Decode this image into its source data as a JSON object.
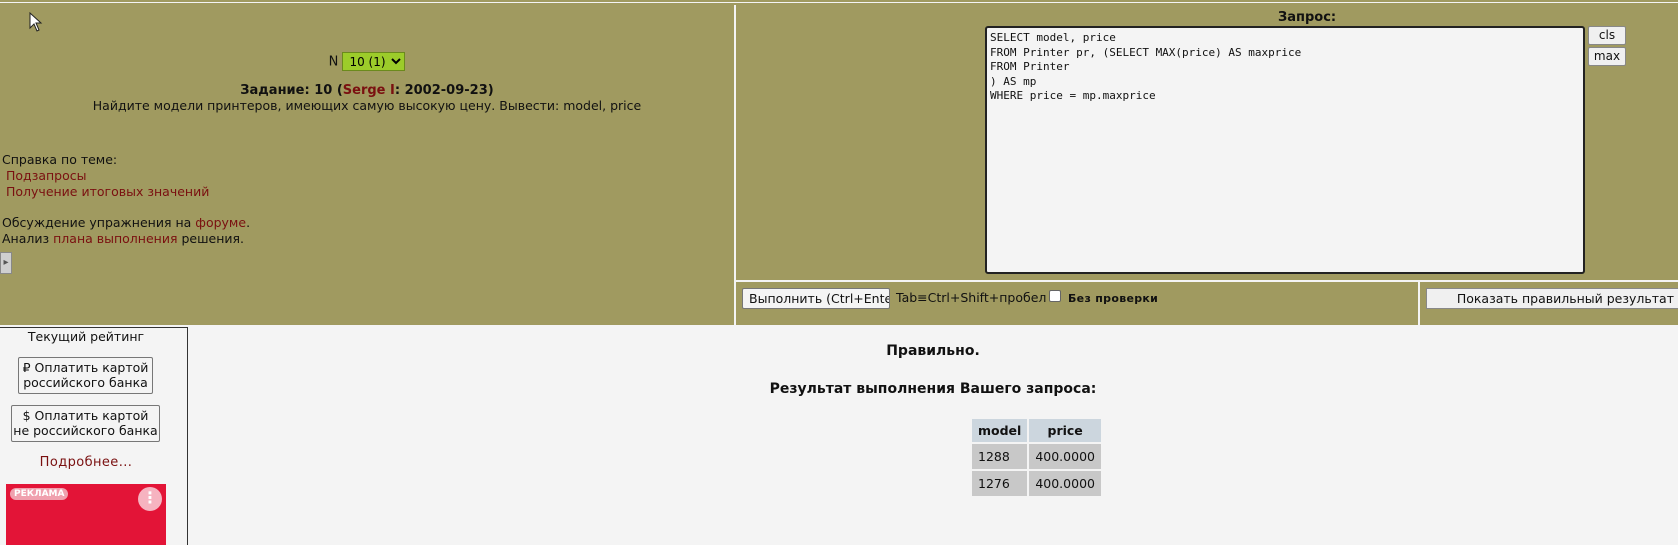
{
  "task": {
    "n_label": "N",
    "selected_option": "10 (1)",
    "title_prefix": "Задание: 10 (",
    "author": "Serge I",
    "title_suffix": ": 2002-09-23)",
    "description": "Найдите модели принтеров, имеющих самую высокую цену. Вывести: model, price"
  },
  "help": {
    "heading": "Справка по теме:",
    "links": [
      "Подзапросы",
      "Получение итоговых значений"
    ]
  },
  "discussion": {
    "prefix": "Обсуждение упражнения на ",
    "link": "форуме",
    "suffix": "."
  },
  "analysis": {
    "prefix": "Анализ ",
    "link": "плана выполнения",
    "suffix": " решения."
  },
  "query": {
    "label": "Запрос:",
    "text": "SELECT model, price\nFROM Printer pr, (SELECT MAX(price) AS maxprice\nFROM Printer\n) AS mp\nWHERE price = mp.maxprice",
    "cls_label": "cls",
    "max_label": "max"
  },
  "controls": {
    "execute_label": "Выполнить (Ctrl+Enter)",
    "tab_hint": "Tab≡Ctrl+Shift+пробел",
    "no_check_label": "Без проверки",
    "show_result_label": "Показать правильный результат"
  },
  "sidebar": {
    "rating_label": "Текущий рейтинг",
    "pay_ru_line1": "₽ Оплатить картой",
    "pay_ru_line2": "российского банка",
    "pay_nonru_line1": "$ Оплатить картой",
    "pay_nonru_line2": "не российского банка",
    "more_label": "Подробнее...",
    "ad_label": "РЕКЛАМА"
  },
  "result": {
    "status": "Правильно.",
    "title": "Результат выполнения Вашего запроса:",
    "columns": [
      "model",
      "price"
    ],
    "rows": [
      [
        "1288",
        "400.0000"
      ],
      [
        "1276",
        "400.0000"
      ]
    ]
  },
  "colors": {
    "panel": "#a09a60",
    "link": "#7a1010",
    "select_bg": "#9ccc2a",
    "ad_bg": "#e31437"
  }
}
